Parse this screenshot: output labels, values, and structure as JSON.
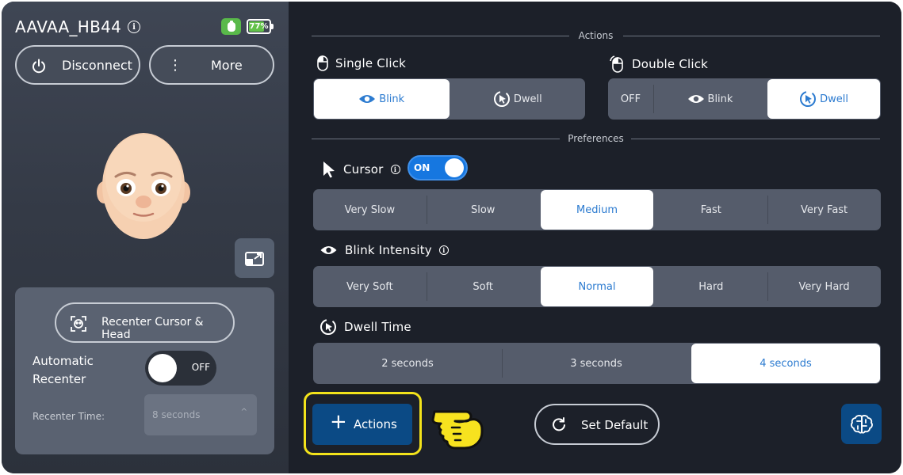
{
  "device": {
    "name": "AAVAA_HB44",
    "battery_percent": 77,
    "battery_label": "77%"
  },
  "left": {
    "disconnect_label": "Disconnect",
    "more_label": "More",
    "recenter_label": "Recenter Cursor & Head",
    "auto_recenter_label": "Automatic Recenter",
    "auto_recenter_state": "OFF",
    "recenter_time_label": "Recenter Time:",
    "recenter_time_value": "8 seconds"
  },
  "actions_section": {
    "heading": "Actions",
    "single_click": {
      "label": "Single Click",
      "options": [
        "Blink",
        "Dwell"
      ],
      "selected": "Blink"
    },
    "double_click": {
      "label": "Double Click",
      "options": [
        "OFF",
        "Blink",
        "Dwell"
      ],
      "selected": "Dwell"
    }
  },
  "preferences": {
    "heading": "Preferences",
    "cursor": {
      "label": "Cursor",
      "toggle": "ON",
      "options": [
        "Very Slow",
        "Slow",
        "Medium",
        "Fast",
        "Very Fast"
      ],
      "selected": "Medium"
    },
    "blink_intensity": {
      "label": "Blink Intensity",
      "options": [
        "Very Soft",
        "Soft",
        "Normal",
        "Hard",
        "Very Hard"
      ],
      "selected": "Normal"
    },
    "dwell_time": {
      "label": "Dwell Time",
      "options": [
        "2 seconds",
        "3 seconds",
        "4 seconds"
      ],
      "selected": "4 seconds"
    }
  },
  "footer": {
    "add_actions_label": "Actions",
    "set_default_label": "Set Default"
  },
  "colors": {
    "accent": "#2c7bd0",
    "toggle_on": "#1677e0",
    "highlight": "#f3e31b",
    "battery": "#63c24a",
    "primary_button": "#0b4a85"
  },
  "icons": [
    "info-icon",
    "device-icon",
    "battery-icon",
    "power-icon",
    "more-vertical-icon",
    "expand-icon",
    "recenter-icon",
    "mouse-left-icon",
    "mouse-double-icon",
    "eye-icon",
    "dwell-icon",
    "cursor-icon",
    "plus-icon",
    "pointing-hand-icon",
    "reset-icon",
    "brain-icon",
    "chevron-up-icon"
  ]
}
